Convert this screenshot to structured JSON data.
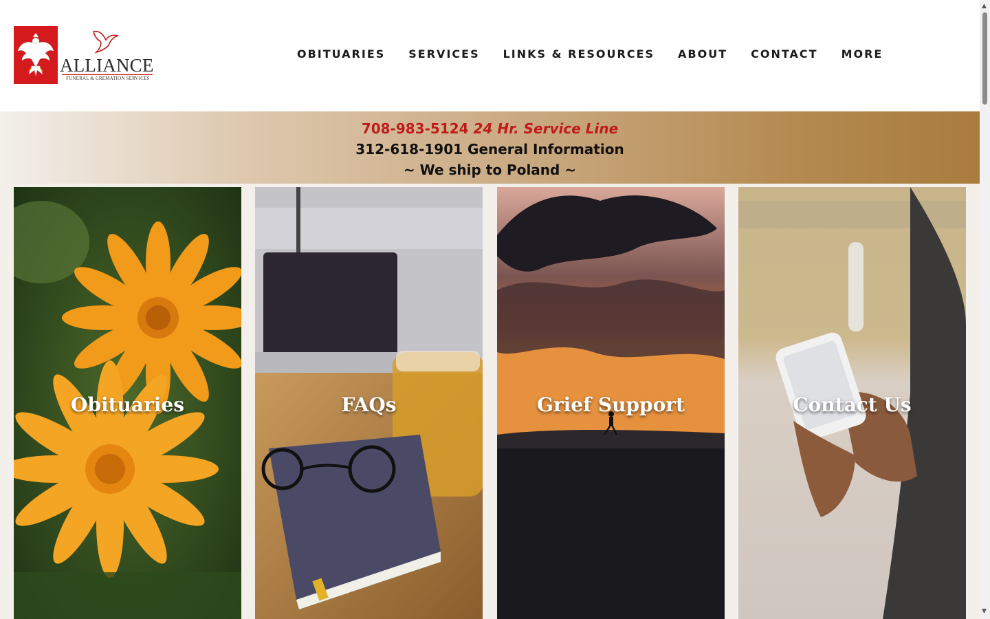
{
  "logo": {
    "name": "ALLIANCE",
    "tagline": "FUNERAL & CREMATION SERVICES",
    "brand_color": "#d51a1e"
  },
  "nav": {
    "items": [
      "OBITUARIES",
      "SERVICES",
      "LINKS & RESOURCES",
      "ABOUT",
      "CONTACT",
      "MORE"
    ]
  },
  "banner": {
    "service_phone": "708-983-5124",
    "service_label": "24 Hr. Service Line",
    "info_line": "312-618-1901 General Information",
    "shipping_line": "~ We ship to Poland ~",
    "accent_color": "#c01b1b"
  },
  "cards": [
    {
      "label": "Obituaries",
      "image": "orange-flowers"
    },
    {
      "label": "FAQs",
      "image": "desk-tea-glasses"
    },
    {
      "label": "Grief Support",
      "image": "sunset-silhouette"
    },
    {
      "label": "Contact Us",
      "image": "hands-phone"
    }
  ]
}
